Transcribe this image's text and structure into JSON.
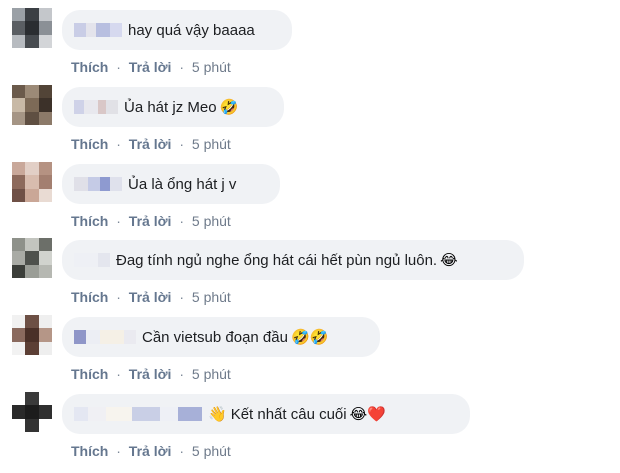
{
  "actions": {
    "like": "Thích",
    "reply": "Trả lời",
    "separator": "·"
  },
  "comments": [
    {
      "text": "hay quá vậy baaaa",
      "emoji": "",
      "time": "5 phút"
    },
    {
      "text": "Ủa hát jz Meo",
      "emoji": "🤣",
      "time": "5 phút"
    },
    {
      "text": "Ủa là ổng hát j v",
      "emoji": "",
      "time": "5 phút"
    },
    {
      "text": "Đag tính ngủ nghe ổng hát cái hết pùn ngủ luôn.",
      "emoji": "😂",
      "time": "5 phút"
    },
    {
      "text": "Cần vietsub đoạn đầu",
      "emoji": "🤣🤣",
      "time": "5 phút"
    },
    {
      "text": "Kết nhất câu cuối",
      "emoji": "😂❤️",
      "prefix_emoji": "👋",
      "time": "5 phút"
    }
  ],
  "colors": {
    "bubble": "#f0f2f5",
    "text": "#1c1e21",
    "action": "#65778f",
    "heart": "#e0245e"
  }
}
